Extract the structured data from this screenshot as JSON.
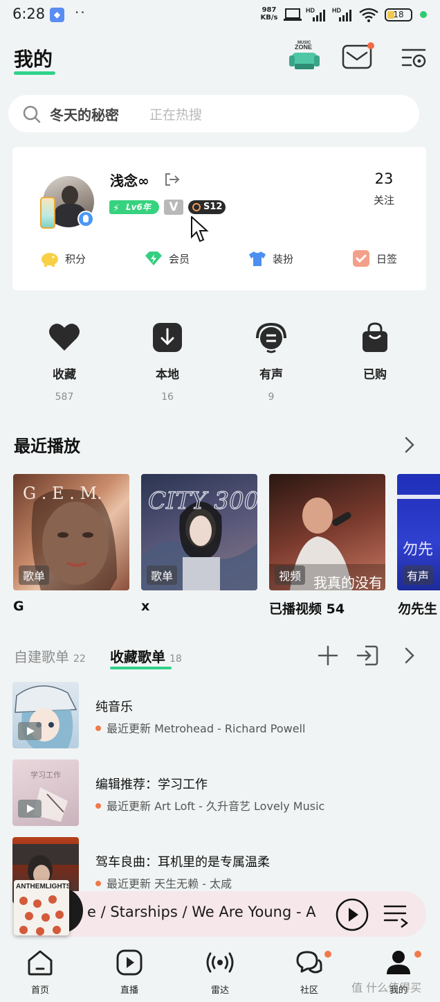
{
  "status_bar": {
    "time": "6:28",
    "network_speed": "987",
    "network_unit": "KB/s",
    "battery": "18",
    "hd1": "HD",
    "hd2": "HD"
  },
  "header": {
    "title": "我的",
    "music_zone_label_1": "MUSIC",
    "music_zone_label_2": "ZONE"
  },
  "search": {
    "hot_term": "冬天的秘密",
    "hint": "正在热搜"
  },
  "profile": {
    "username": "浅念∞",
    "level_badge": "Lv6年",
    "vip_badge": "V",
    "season_badge": "S12",
    "follow_count": "23",
    "follow_label": "关注",
    "actions": [
      {
        "label": "积分",
        "icon": "piggy-bank-icon",
        "color": "#f7d046"
      },
      {
        "label": "会员",
        "icon": "diamond-icon",
        "color": "#33cf80"
      },
      {
        "label": "装扮",
        "icon": "tshirt-icon",
        "color": "#4c8ff0"
      },
      {
        "label": "日签",
        "icon": "checkin-icon",
        "color": "#f3a08a"
      }
    ]
  },
  "quick_entries": [
    {
      "label": "收藏",
      "count": "587",
      "icon": "heart-icon"
    },
    {
      "label": "本地",
      "count": "16",
      "icon": "download-icon"
    },
    {
      "label": "有声",
      "count": "9",
      "icon": "audiobook-icon"
    },
    {
      "label": "已购",
      "count": "",
      "icon": "shopping-bag-icon"
    }
  ],
  "recent": {
    "title": "最近播放",
    "items": [
      {
        "name": "G",
        "tag": "歌单",
        "cover_text": "G .  E .  M."
      },
      {
        "name": "x",
        "tag": "歌单",
        "cover_text": "CITY 300"
      },
      {
        "name": "已播视频 54",
        "tag": "视频",
        "cover_text": "我真的没有"
      },
      {
        "name": "勿先生",
        "tag": "有声",
        "cover_text": "勿先"
      }
    ]
  },
  "playlists": {
    "tabs": [
      {
        "label": "自建歌单",
        "count": "22"
      },
      {
        "label": "收藏歌单",
        "count": "18"
      }
    ],
    "items": [
      {
        "title": "纯音乐",
        "subtitle": "最近更新 Metrohead - Richard Powell"
      },
      {
        "title": "编辑推荐：学习工作",
        "subtitle": "最近更新 Art Loft - 久升音艺 Lovely Music",
        "cover_text": "学习工作"
      },
      {
        "title": "驾车良曲：耳机里的是专属温柔",
        "subtitle": "最近更新 天生无赖 - 太咸"
      }
    ]
  },
  "mini_player": {
    "title": "e / Starships / We Are Young - A",
    "cover_text": "ANTHEMLIGHTS"
  },
  "bottom_nav": [
    {
      "label": "首页",
      "icon": "home-icon"
    },
    {
      "label": "直播",
      "icon": "live-play-icon"
    },
    {
      "label": "雷达",
      "icon": "radar-icon"
    },
    {
      "label": "社区",
      "icon": "chat-bubbles-icon"
    },
    {
      "label": "我的",
      "icon": "user-icon"
    }
  ],
  "watermark": "值 什么值得买"
}
